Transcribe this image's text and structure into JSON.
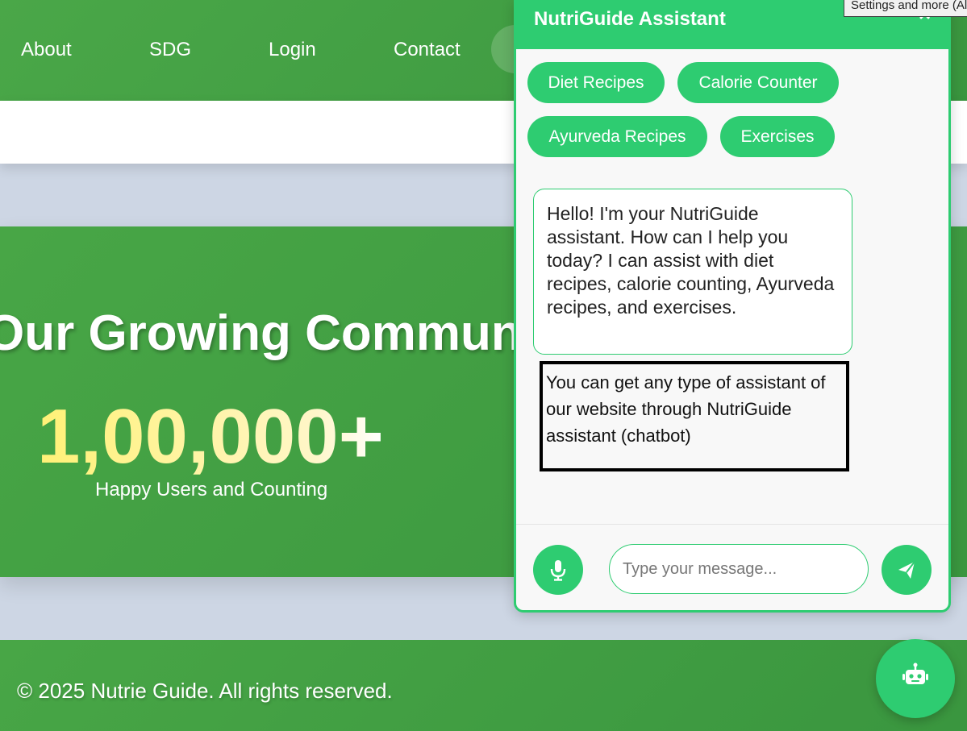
{
  "nav": {
    "links": [
      "About",
      "SDG",
      "Login",
      "Contact"
    ]
  },
  "community": {
    "title": "Our Growing Community",
    "count": "1,00,000+",
    "subtitle": "Happy Users and Counting"
  },
  "footer": {
    "copyright": "© 2025 Nutrie Guide. All rights reserved."
  },
  "chat": {
    "title": "NutriGuide Assistant",
    "close_label": "×",
    "chips": [
      "Diet Recipes",
      "Calorie Counter",
      "Ayurveda Recipes",
      "Exercises"
    ],
    "bot_message": "Hello! I'm your NutriGuide assistant. How can I help you today? I can assist with diet recipes, calorie counting, Ayurveda recipes, and exercises.",
    "note": "You can get any type of assistant of our website through NutriGuide assistant (chatbot)",
    "input_placeholder": "Type your message...",
    "input_value": ""
  },
  "tooltip": "Settings and more (Alt+F)",
  "icons": {
    "mic": "microphone-icon",
    "send": "paper-plane-icon",
    "fab": "robot-icon",
    "close": "close-icon"
  },
  "colors": {
    "brand_green": "#3a963f",
    "chat_green": "#2ecc71",
    "accent_yellow": "#fff176",
    "background": "#cdd6e4"
  }
}
